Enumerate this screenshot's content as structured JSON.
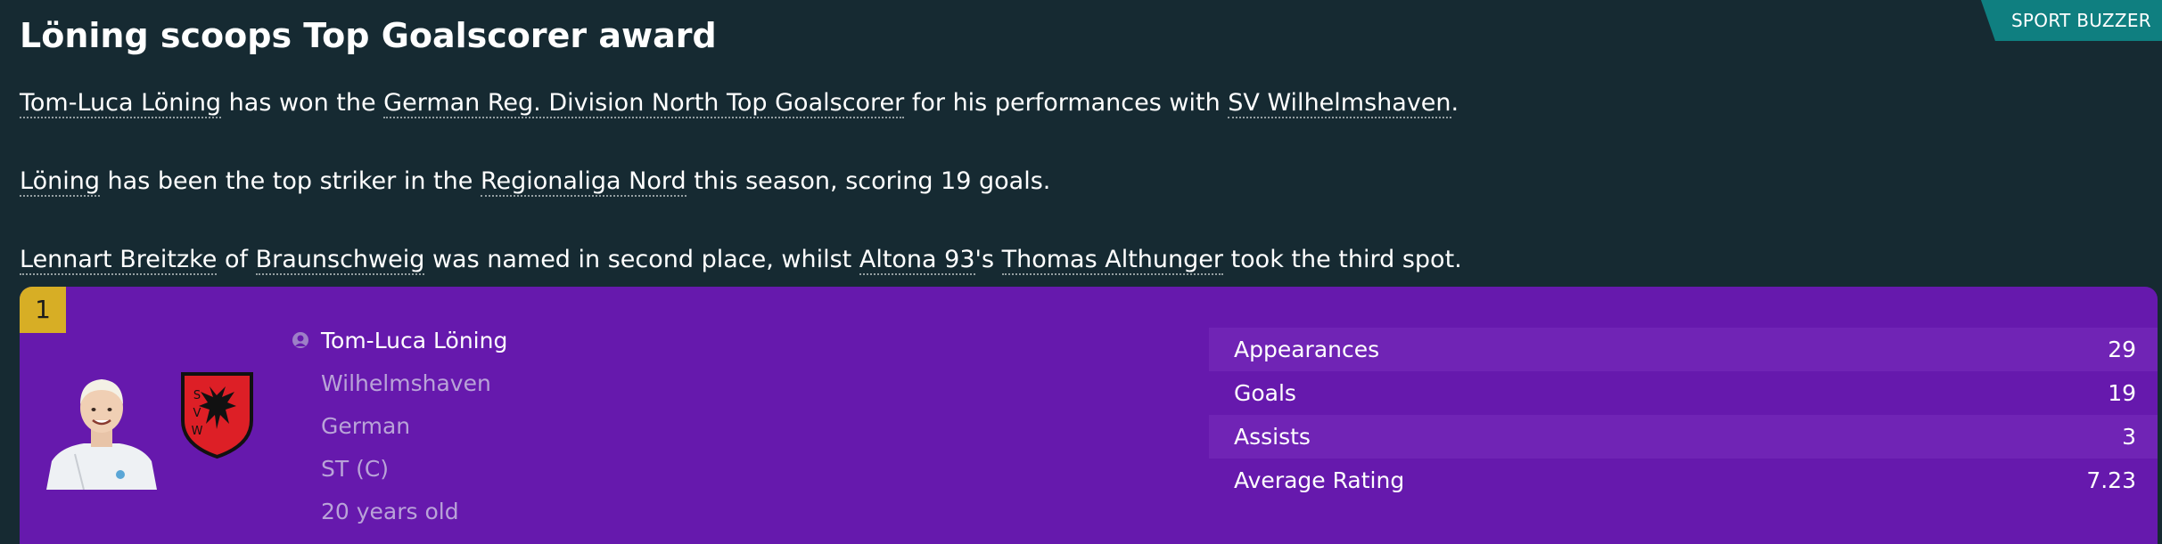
{
  "source": "SPORT BUZZER",
  "headline": "Löning scoops Top Goalscorer award",
  "paragraphs": {
    "p1": {
      "player": "Tom-Luca Löning",
      "t1": " has won the ",
      "award": "German Reg. Division North Top Goalscorer",
      "t2": " for his performances with ",
      "club": "SV Wilhelmshaven",
      "t3": "."
    },
    "p2": {
      "player": "Löning",
      "t1": " has been the top striker in the ",
      "league": "Regionaliga Nord",
      "t2": " this season, scoring 19 goals."
    },
    "p3": {
      "second": "Lennart Breitzke",
      "t1": " of ",
      "second_club": "Braunschweig",
      "t2": " was named in second place, whilst ",
      "third_club": "Altona 93",
      "t3": "'s ",
      "third": "Thomas Althunger",
      "t4": " took the third spot."
    }
  },
  "card": {
    "rank": "1",
    "player_name": "Tom-Luca Löning",
    "club": "Wilhelmshaven",
    "nationality": "German",
    "position": "ST (C)",
    "age": "20 years old",
    "crest_letters": [
      "S",
      "V",
      "W"
    ],
    "colors": {
      "card": "#6619ad",
      "rank_badge": "#d7ae25",
      "crest_red": "#dd1f26"
    },
    "stats": [
      {
        "label": "Appearances",
        "value": "29"
      },
      {
        "label": "Goals",
        "value": "19"
      },
      {
        "label": "Assists",
        "value": "3"
      },
      {
        "label": "Average Rating",
        "value": "7.23"
      }
    ]
  }
}
